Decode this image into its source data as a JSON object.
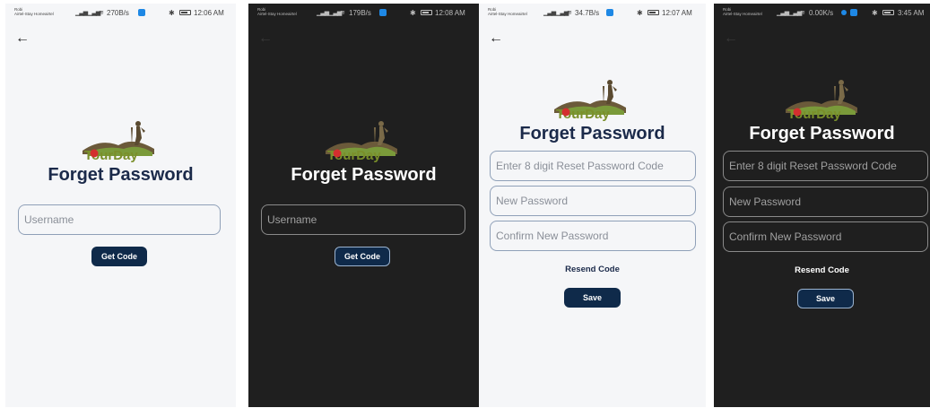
{
  "screens": [
    {
      "theme": "light",
      "status": {
        "carrier1": "Robi",
        "carrier2": "Airtel-Stay Homeairtel",
        "speed": "270B/s",
        "time": "12:06 AM"
      },
      "logo_text": "TourDay",
      "title": "Forget Password",
      "fields": [
        "Username"
      ],
      "button": "Get Code"
    },
    {
      "theme": "dark",
      "status": {
        "carrier1": "Robi",
        "carrier2": "Airtel-Stay Homeairtel",
        "speed": "179B/s",
        "time": "12:08 AM"
      },
      "logo_text": "TourDay",
      "title": "Forget Password",
      "fields": [
        "Username"
      ],
      "button": "Get Code"
    },
    {
      "theme": "light",
      "status": {
        "carrier1": "Robi",
        "carrier2": "Airtel-Stay Homeairtel",
        "speed": "34.7B/s",
        "time": "12:07 AM"
      },
      "logo_text": "TourDay",
      "title": "Forget Password",
      "fields": [
        "Enter 8 digit Reset Password Code",
        "New Password",
        "Confirm New Password"
      ],
      "link": "Resend Code",
      "button": "Save"
    },
    {
      "theme": "dark",
      "status": {
        "carrier1": "Robi",
        "carrier2": "Airtel-Stay Homeairtel",
        "speed": "0.00K/s",
        "time": "3:45 AM"
      },
      "logo_text": "TourDay",
      "title": "Forget Password",
      "fields": [
        "Enter 8 digit Reset Password Code",
        "New Password",
        "Confirm New Password"
      ],
      "link": "Resend Code",
      "button": "Save"
    }
  ],
  "icons": {
    "back": "arrow-left-icon",
    "signal": "signal-icon",
    "wifi": "wifi-icon",
    "battery": "battery-icon",
    "bluetooth": "bluetooth-icon"
  },
  "colors": {
    "navy": "#0f2a4a",
    "dark_bg": "#1f1f1f",
    "light_bg": "#f5f6f8",
    "logo_red": "#d32f2f",
    "logo_green": "#6b8e23"
  }
}
